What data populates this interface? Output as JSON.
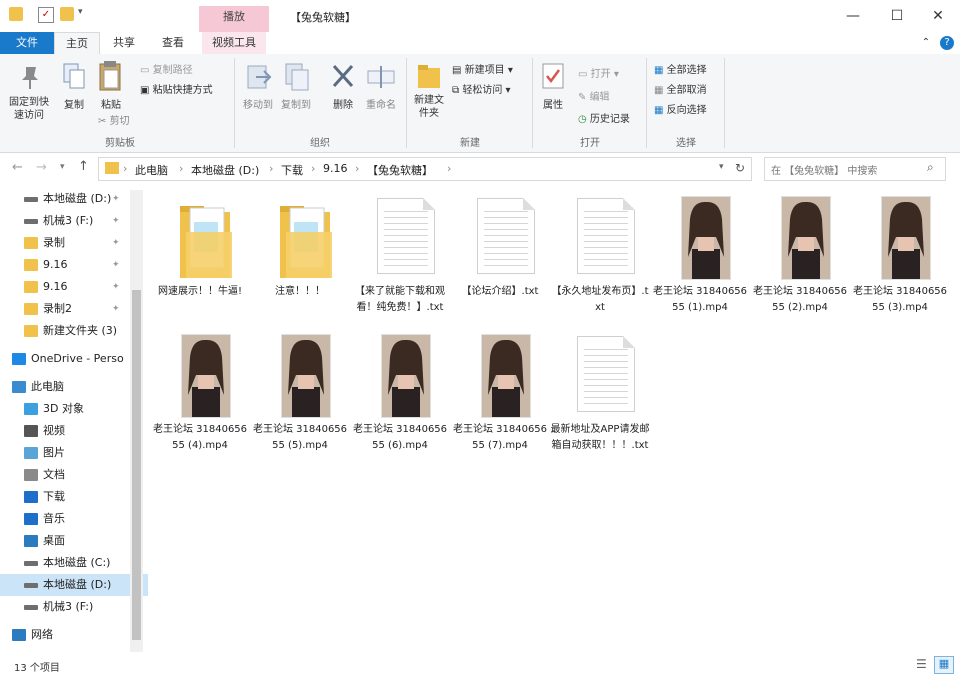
{
  "window": {
    "title": "【兔兔软糖】",
    "context_tab": "播放",
    "minimize": "—",
    "maximize": "☐",
    "close": "✕"
  },
  "ribbon_tabs": {
    "file": "文件",
    "home": "主页",
    "share": "共享",
    "view": "查看",
    "video_tools": "视频工具"
  },
  "ribbon": {
    "pin": "固定到快速访问",
    "copy": "复制",
    "paste": "粘贴",
    "copy_path": "复制路径",
    "paste_shortcut": "粘贴快捷方式",
    "cut": "剪切",
    "clipboard_group": "剪贴板",
    "move_to": "移动到",
    "copy_to": "复制到",
    "delete": "删除",
    "rename": "重命名",
    "organize_group": "组织",
    "new_folder": "新建文件夹",
    "new_item": "新建项目 ▾",
    "easy_access": "轻松访问 ▾",
    "new_group": "新建",
    "properties": "属性",
    "open": "打开 ▾",
    "edit": "编辑",
    "history": "历史记录",
    "open_group": "打开",
    "select_all": "全部选择",
    "select_none": "全部取消",
    "invert_select": "反向选择",
    "select_group": "选择",
    "help": "?"
  },
  "address": {
    "crumbs": [
      "此电脑",
      "本地磁盘 (D:)",
      "下载",
      "9.16",
      "【兔兔软糖】"
    ],
    "search_placeholder": "在 【兔兔软糖】 中搜索"
  },
  "nav": {
    "items": [
      {
        "label": "本地磁盘 (D:)",
        "icon": "drive-icon"
      },
      {
        "label": "机械3 (F:)",
        "icon": "drive-icon"
      },
      {
        "label": "录制",
        "icon": "folder-icon"
      },
      {
        "label": "9.16",
        "icon": "folder-icon"
      },
      {
        "label": "9.16",
        "icon": "folder-icon"
      },
      {
        "label": "录制2",
        "icon": "folder-icon"
      },
      {
        "label": "新建文件夹 (3)",
        "icon": "folder-icon"
      },
      {
        "label": "OneDrive - Perso",
        "icon": "cloud-icon"
      },
      {
        "label": "此电脑",
        "icon": "pc-icon"
      },
      {
        "label": "3D 对象",
        "icon": "cube-icon"
      },
      {
        "label": "视频",
        "icon": "video-icon"
      },
      {
        "label": "图片",
        "icon": "picture-icon"
      },
      {
        "label": "文档",
        "icon": "document-icon"
      },
      {
        "label": "下载",
        "icon": "download-icon"
      },
      {
        "label": "音乐",
        "icon": "music-icon"
      },
      {
        "label": "桌面",
        "icon": "desktop-icon"
      },
      {
        "label": "本地磁盘 (C:)",
        "icon": "drive-icon"
      },
      {
        "label": "本地磁盘 (D:)",
        "icon": "drive-icon"
      },
      {
        "label": "机械3 (F:)",
        "icon": "drive-icon"
      },
      {
        "label": "网络",
        "icon": "network-icon"
      }
    ]
  },
  "files": [
    {
      "name": "网速展示！！牛逼!",
      "type": "folder"
    },
    {
      "name": "注意！！！",
      "type": "folder"
    },
    {
      "name": "【来了就能下载和观看！纯免费！】.txt",
      "type": "txt"
    },
    {
      "name": "【论坛介绍】.txt",
      "type": "txt"
    },
    {
      "name": "【永久地址发布页】.txt",
      "type": "txt"
    },
    {
      "name": "老王论坛 3184065655 (1).mp4",
      "type": "mp4"
    },
    {
      "name": "老王论坛 3184065655 (2).mp4",
      "type": "mp4"
    },
    {
      "name": "老王论坛 3184065655 (3).mp4",
      "type": "mp4"
    },
    {
      "name": "老王论坛 3184065655 (4).mp4",
      "type": "mp4"
    },
    {
      "name": "老王论坛 3184065655 (5).mp4",
      "type": "mp4"
    },
    {
      "name": "老王论坛 3184065655 (6).mp4",
      "type": "mp4"
    },
    {
      "name": "老王论坛 3184065655 (7).mp4",
      "type": "mp4"
    },
    {
      "name": "最新地址及APP请发邮箱自动获取！！！.txt",
      "type": "txt"
    }
  ],
  "status": {
    "count": "13 个项目"
  },
  "colors": {
    "accent": "#1979ca",
    "folder": "#f0c24b",
    "context_tab": "#f6c8d6",
    "selected_nav": "#cce4f7"
  }
}
